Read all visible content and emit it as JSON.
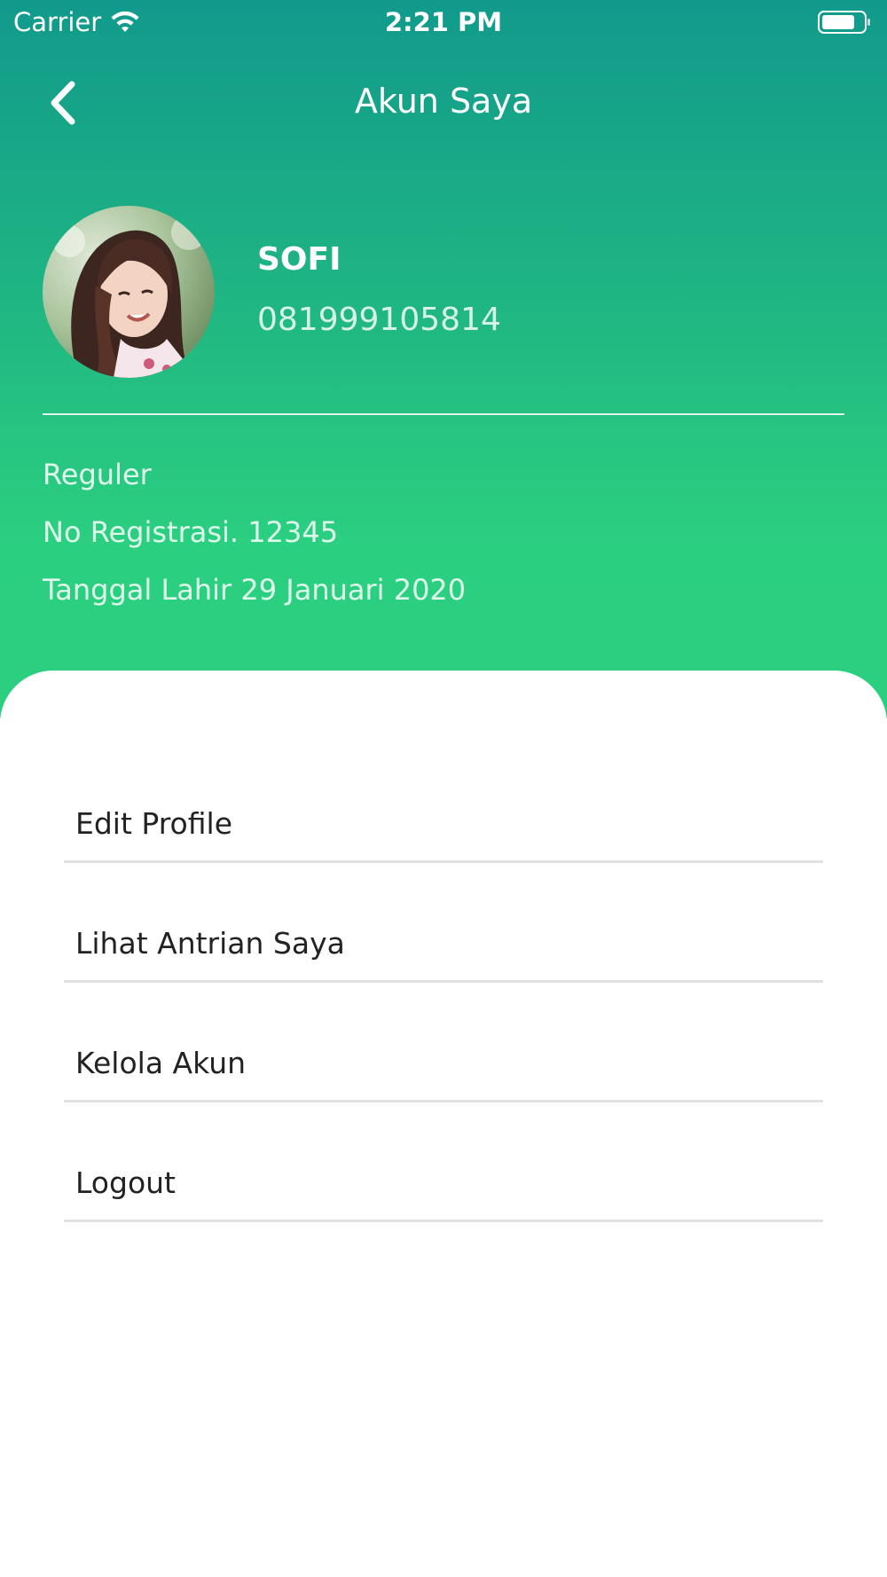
{
  "status_bar": {
    "carrier": "Carrier",
    "time": "2:21 PM",
    "icons": [
      "wifi-icon",
      "battery-icon"
    ]
  },
  "nav": {
    "title": "Akun Saya",
    "back_icon": "chevron-left-icon"
  },
  "profile": {
    "name": "SOFI",
    "phone": "081999105814",
    "membership": "Reguler",
    "registration": "No Registrasi. 12345",
    "birth_date": "Tanggal Lahir 29 Januari 2020"
  },
  "menu": {
    "items": [
      {
        "label": "Edit Profile"
      },
      {
        "label": "Lihat Antrian Saya"
      },
      {
        "label": "Kelola Akun"
      },
      {
        "label": "Logout"
      }
    ]
  },
  "colors": {
    "gradient_top": "#119a8c",
    "gradient_bottom": "#2ccf80",
    "text_dark": "#222222",
    "divider_light": "#e2e2e2"
  }
}
